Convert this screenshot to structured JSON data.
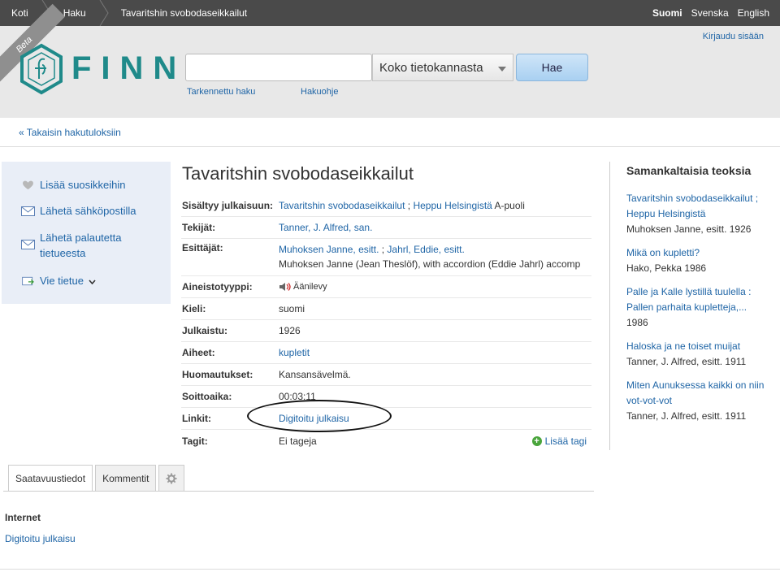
{
  "topbar": {
    "crumbs": [
      "Koti",
      "Haku",
      "Tavaritshin svobodaseikkailut"
    ],
    "langs": [
      "Suomi",
      "Svenska",
      "English"
    ]
  },
  "header": {
    "beta": "Beta",
    "logo_text": "FINNA",
    "search_value": "",
    "scope": "Koko tietokannasta",
    "search_button": "Hae",
    "advanced": "Tarkennettu haku",
    "help": "Hakuohje",
    "login": "Kirjaudu sisään"
  },
  "back_link": "« Takaisin hakutuloksiin",
  "sidebar": {
    "items": [
      {
        "label": "Lisää suosikkeihin",
        "icon": "heart-icon"
      },
      {
        "label": "Lähetä sähköpostilla",
        "icon": "envelope-icon"
      },
      {
        "label_1": "Lähetä palautetta",
        "label_2": "tietueesta",
        "icon": "envelope-icon"
      },
      {
        "label": "Vie tietue",
        "icon": "export-icon"
      }
    ]
  },
  "record": {
    "title": "Tavaritshin svobodaseikkailut",
    "rows": {
      "included": {
        "label": "Sisältyy julkaisuun:",
        "link1": "Tavaritshin svobodaseikkailut",
        "sep": " ; ",
        "link2": "Heppu Helsingistä",
        "suffix": " A-puoli"
      },
      "authors": {
        "label": "Tekijät:",
        "value": "Tanner, J. Alfred, san."
      },
      "performers": {
        "label": "Esittäjät:",
        "link1": "Muhoksen Janne, esitt.",
        "sep": " ; ",
        "link2": "Jahrl, Eddie, esitt.",
        "line2": "Muhoksen Janne (Jean Theslöf), with accordion (Eddie Jahrl) accomp"
      },
      "format": {
        "label": "Aineistotyyppi:",
        "value": "Äänilevy"
      },
      "language": {
        "label": "Kieli:",
        "value": "suomi"
      },
      "published": {
        "label": "Julkaistu:",
        "value": "1926"
      },
      "subjects": {
        "label": "Aiheet:",
        "value": "kupletit"
      },
      "notes": {
        "label": "Huomautukset:",
        "value": "Kansansävelmä."
      },
      "duration": {
        "label": "Soittoaika:",
        "value": "00:03:11"
      },
      "links": {
        "label": "Linkit:",
        "value": "Digitoitu julkaisu"
      },
      "tags": {
        "label": "Tagit:",
        "value": "Ei tageja",
        "add": "Lisää tagi"
      }
    }
  },
  "similar": {
    "heading": "Samankaltaisia teoksia",
    "items": [
      {
        "title": "Tavaritshin svobodaseikkailut ; Heppu Helsingistä",
        "sub": "Muhoksen Janne, esitt. 1926"
      },
      {
        "title": "Mikä on kupletti?",
        "sub": "Hako, Pekka 1986"
      },
      {
        "title": "Palle ja Kalle lystillä tuulella : Pallen parhaita kupletteja,...",
        "sub": "1986"
      },
      {
        "title": "Haloska ja ne toiset muijat",
        "sub": "Tanner, J. Alfred, esitt. 1911"
      },
      {
        "title": "Miten Aunuksessa kaikki on niin vot-vot-vot",
        "sub": "Tanner, J. Alfred, esitt. 1911"
      }
    ]
  },
  "tabs": [
    "Saatavuustiedot",
    "Kommentit"
  ],
  "holdings": {
    "heading": "Internet",
    "link": "Digitoitu julkaisu"
  },
  "colors": {
    "topbar": "#4a4a4a",
    "header": "#e8e8e8",
    "link": "#1f65a6",
    "logo": "#1f8a8a",
    "sidebar": "#e9eef7"
  }
}
